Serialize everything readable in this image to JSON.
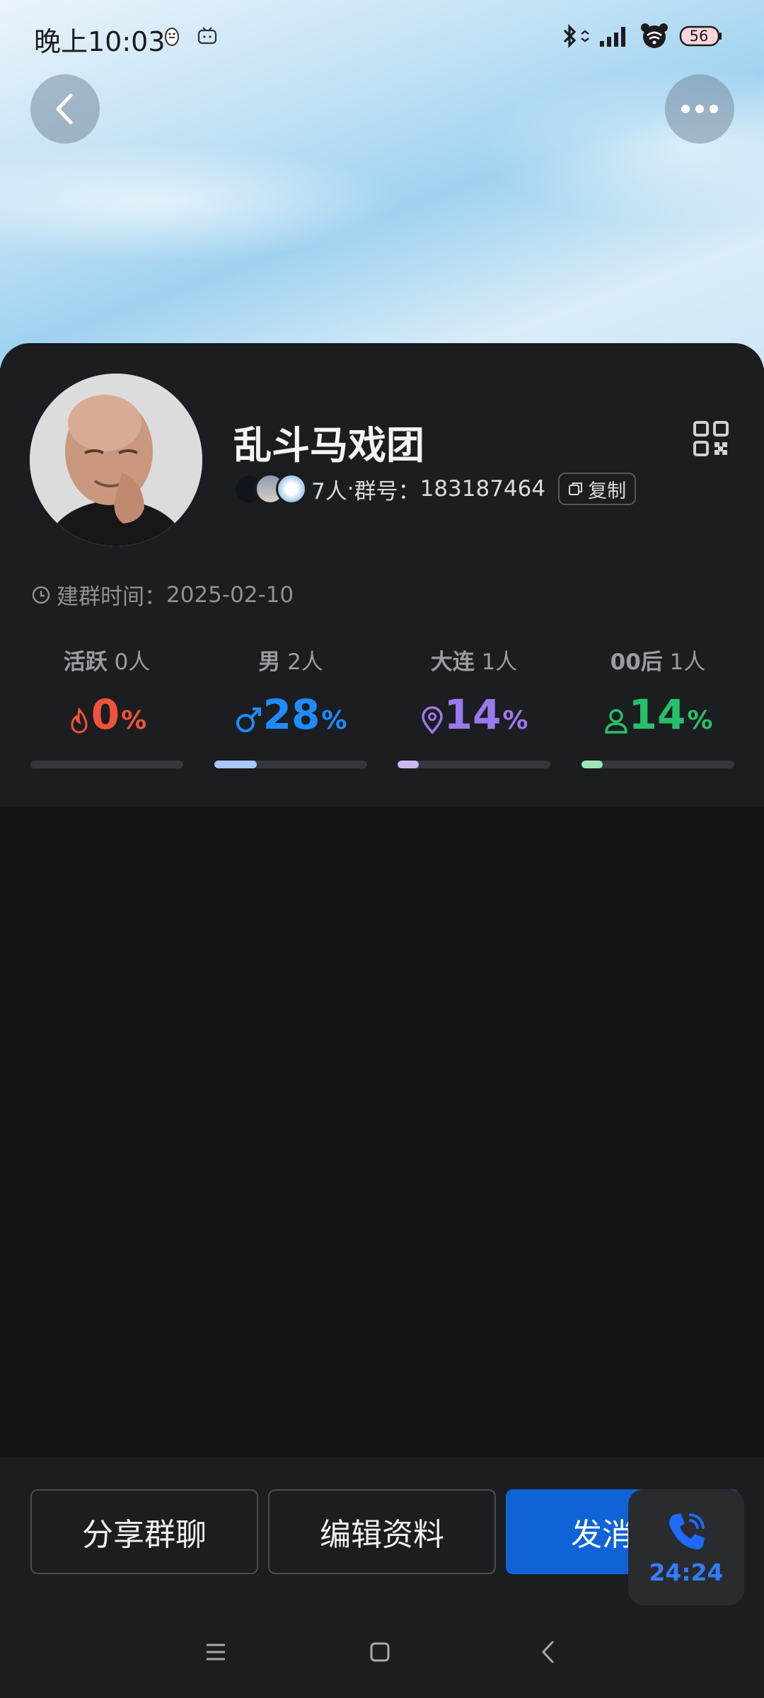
{
  "status_bar": {
    "time": "晚上10:03",
    "battery": "56"
  },
  "group": {
    "name": "乱斗马戏团",
    "member_count": "7人",
    "separator": " · ",
    "id_label": "群号：",
    "id": "183187464",
    "copy_label": "复制",
    "created_label": "建群时间：",
    "created_date": "2025-02-10"
  },
  "stats": [
    {
      "label_bold": "活跃",
      "label_count": "0人",
      "value": "0",
      "unit": "%",
      "color": "#f0533a",
      "fill_fraction": 0.0
    },
    {
      "label_bold": "男",
      "label_count": "2人",
      "value": "28",
      "unit": "%",
      "color": "#1e8cff",
      "fill_fraction": 0.28
    },
    {
      "label_bold": "大连",
      "label_count": "1人",
      "value": "14",
      "unit": "%",
      "color": "#9b78ee",
      "fill_fraction": 0.14
    },
    {
      "label_bold": "00后",
      "label_count": "1人",
      "value": "14",
      "unit": "%",
      "color": "#27c06a",
      "fill_fraction": 0.14
    }
  ],
  "actions": {
    "share": "分享群聊",
    "edit": "编辑资料",
    "send": "发消"
  },
  "call": {
    "duration": "24:24"
  },
  "colors": {
    "accent": "#0f63d6",
    "sheet": "#1c1d20",
    "background": "#131417"
  }
}
